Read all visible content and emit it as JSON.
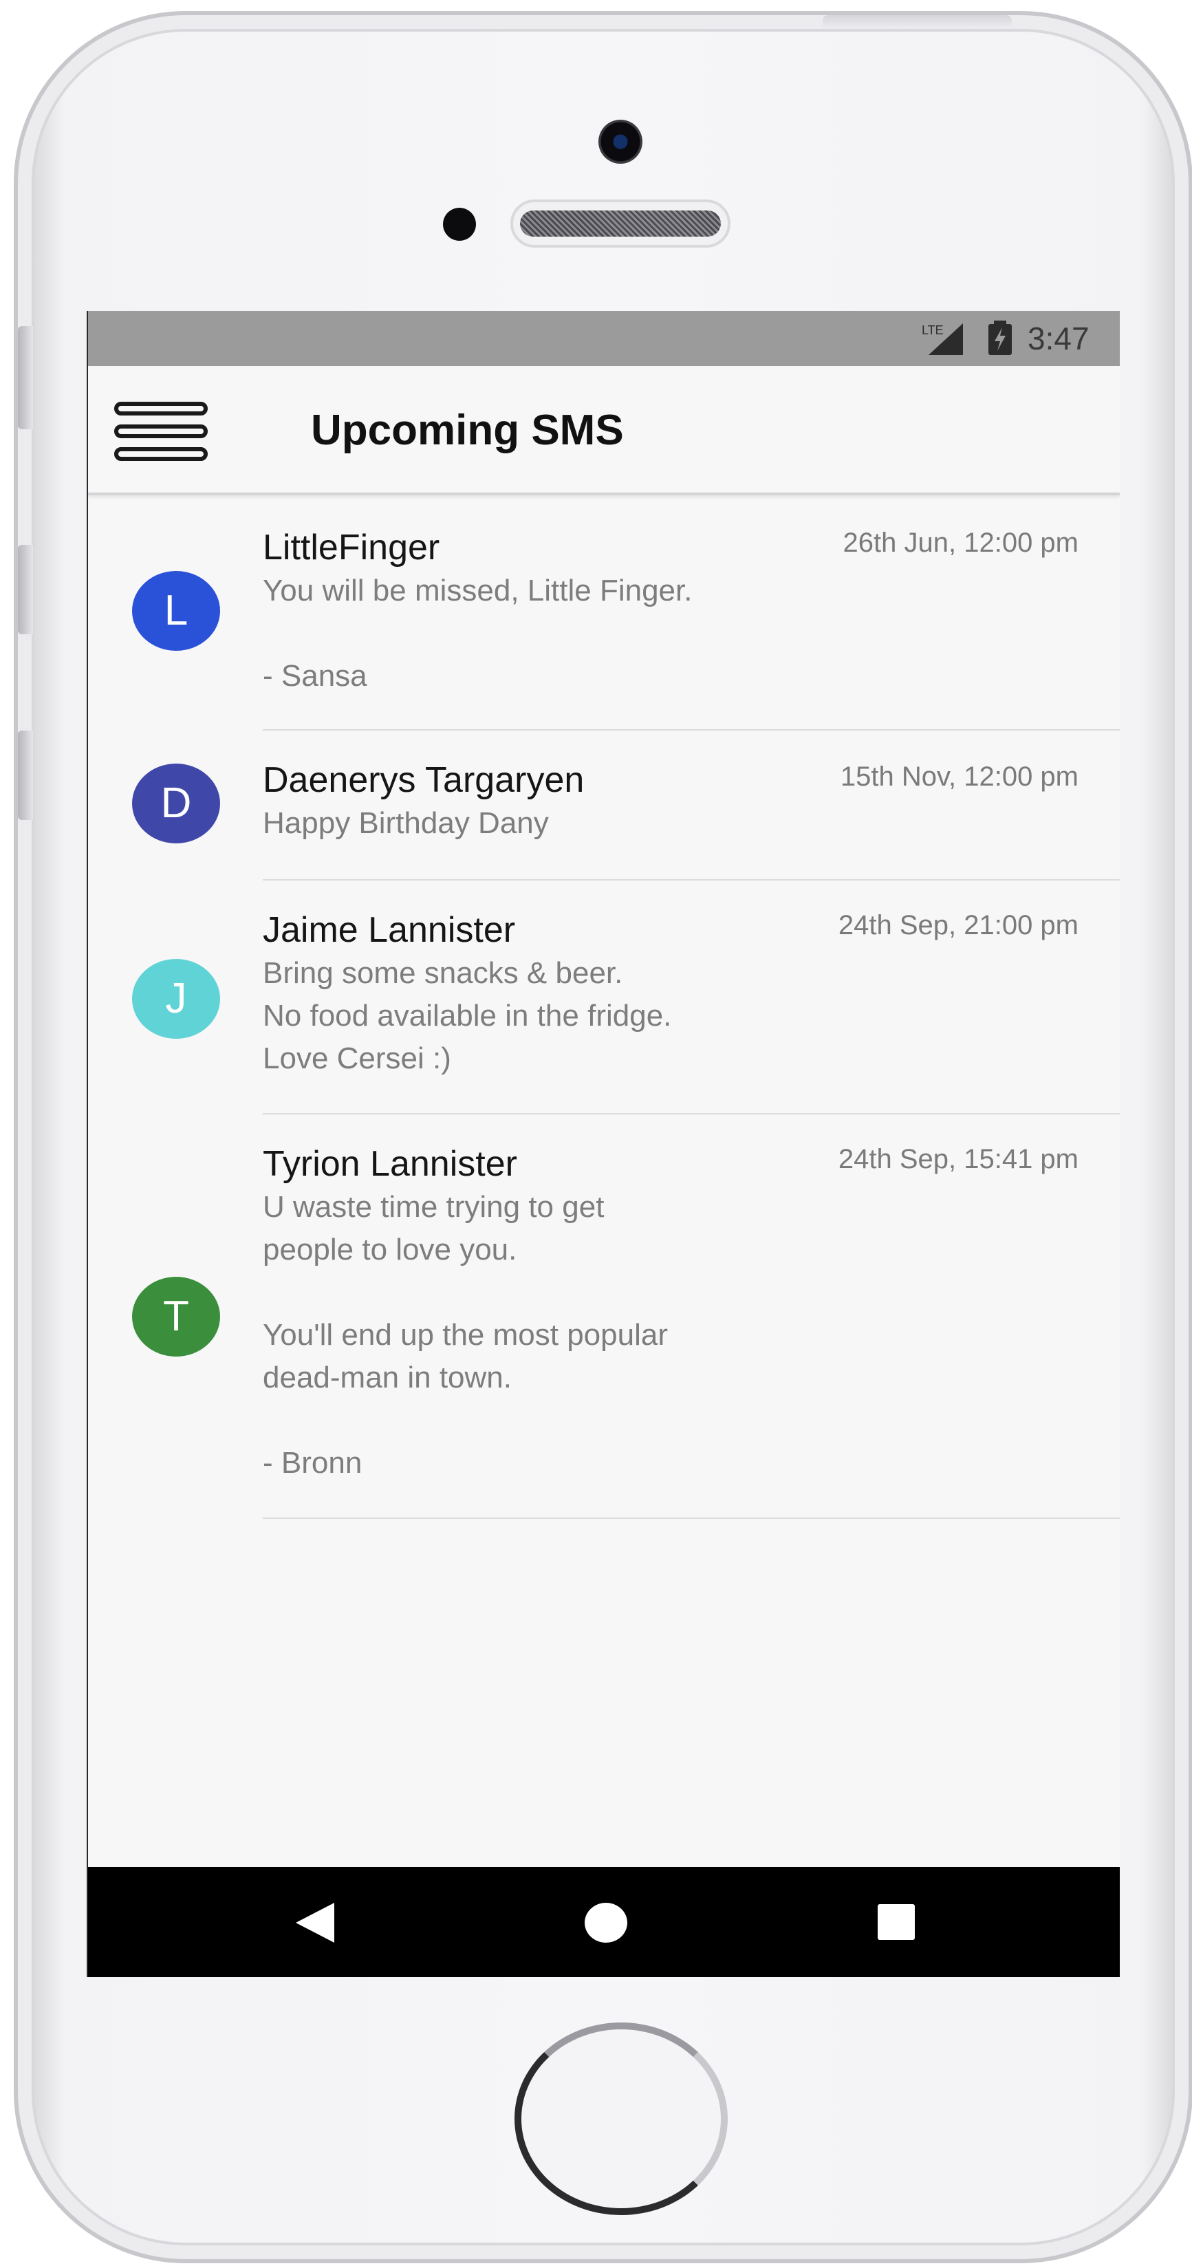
{
  "status_bar": {
    "network": "LTE",
    "time": "3:47"
  },
  "app_bar": {
    "title": "Upcoming SMS",
    "menu_icon": "hamburger-menu-icon"
  },
  "messages": [
    {
      "initial": "L",
      "avatar_color": "#2a52d8",
      "sender": "LittleFinger",
      "time": "26th Jun, 12:00 pm",
      "body": "You will be missed, Little Finger.\n\n- Sansa"
    },
    {
      "initial": "D",
      "avatar_color": "#3f48a8",
      "sender": "Daenerys Targaryen",
      "time": "15th Nov, 12:00 pm",
      "body": "Happy Birthday Dany"
    },
    {
      "initial": "J",
      "avatar_color": "#5fd3d6",
      "sender": "Jaime Lannister",
      "time": "24th Sep, 21:00 pm",
      "body": "Bring some snacks & beer.\nNo food available in the fridge.\nLove Cersei :)"
    },
    {
      "initial": "T",
      "avatar_color": "#3b8f3c",
      "sender": "Tyrion Lannister",
      "time": "24th Sep, 15:41 pm",
      "body": "U waste time trying to get\npeople to love you.\n\nYou'll end up the most popular\ndead-man in town.\n\n- Bronn"
    }
  ],
  "nav_bar": {
    "back_icon": "back-triangle-icon",
    "home_icon": "home-circle-icon",
    "recents_icon": "recents-square-icon"
  }
}
